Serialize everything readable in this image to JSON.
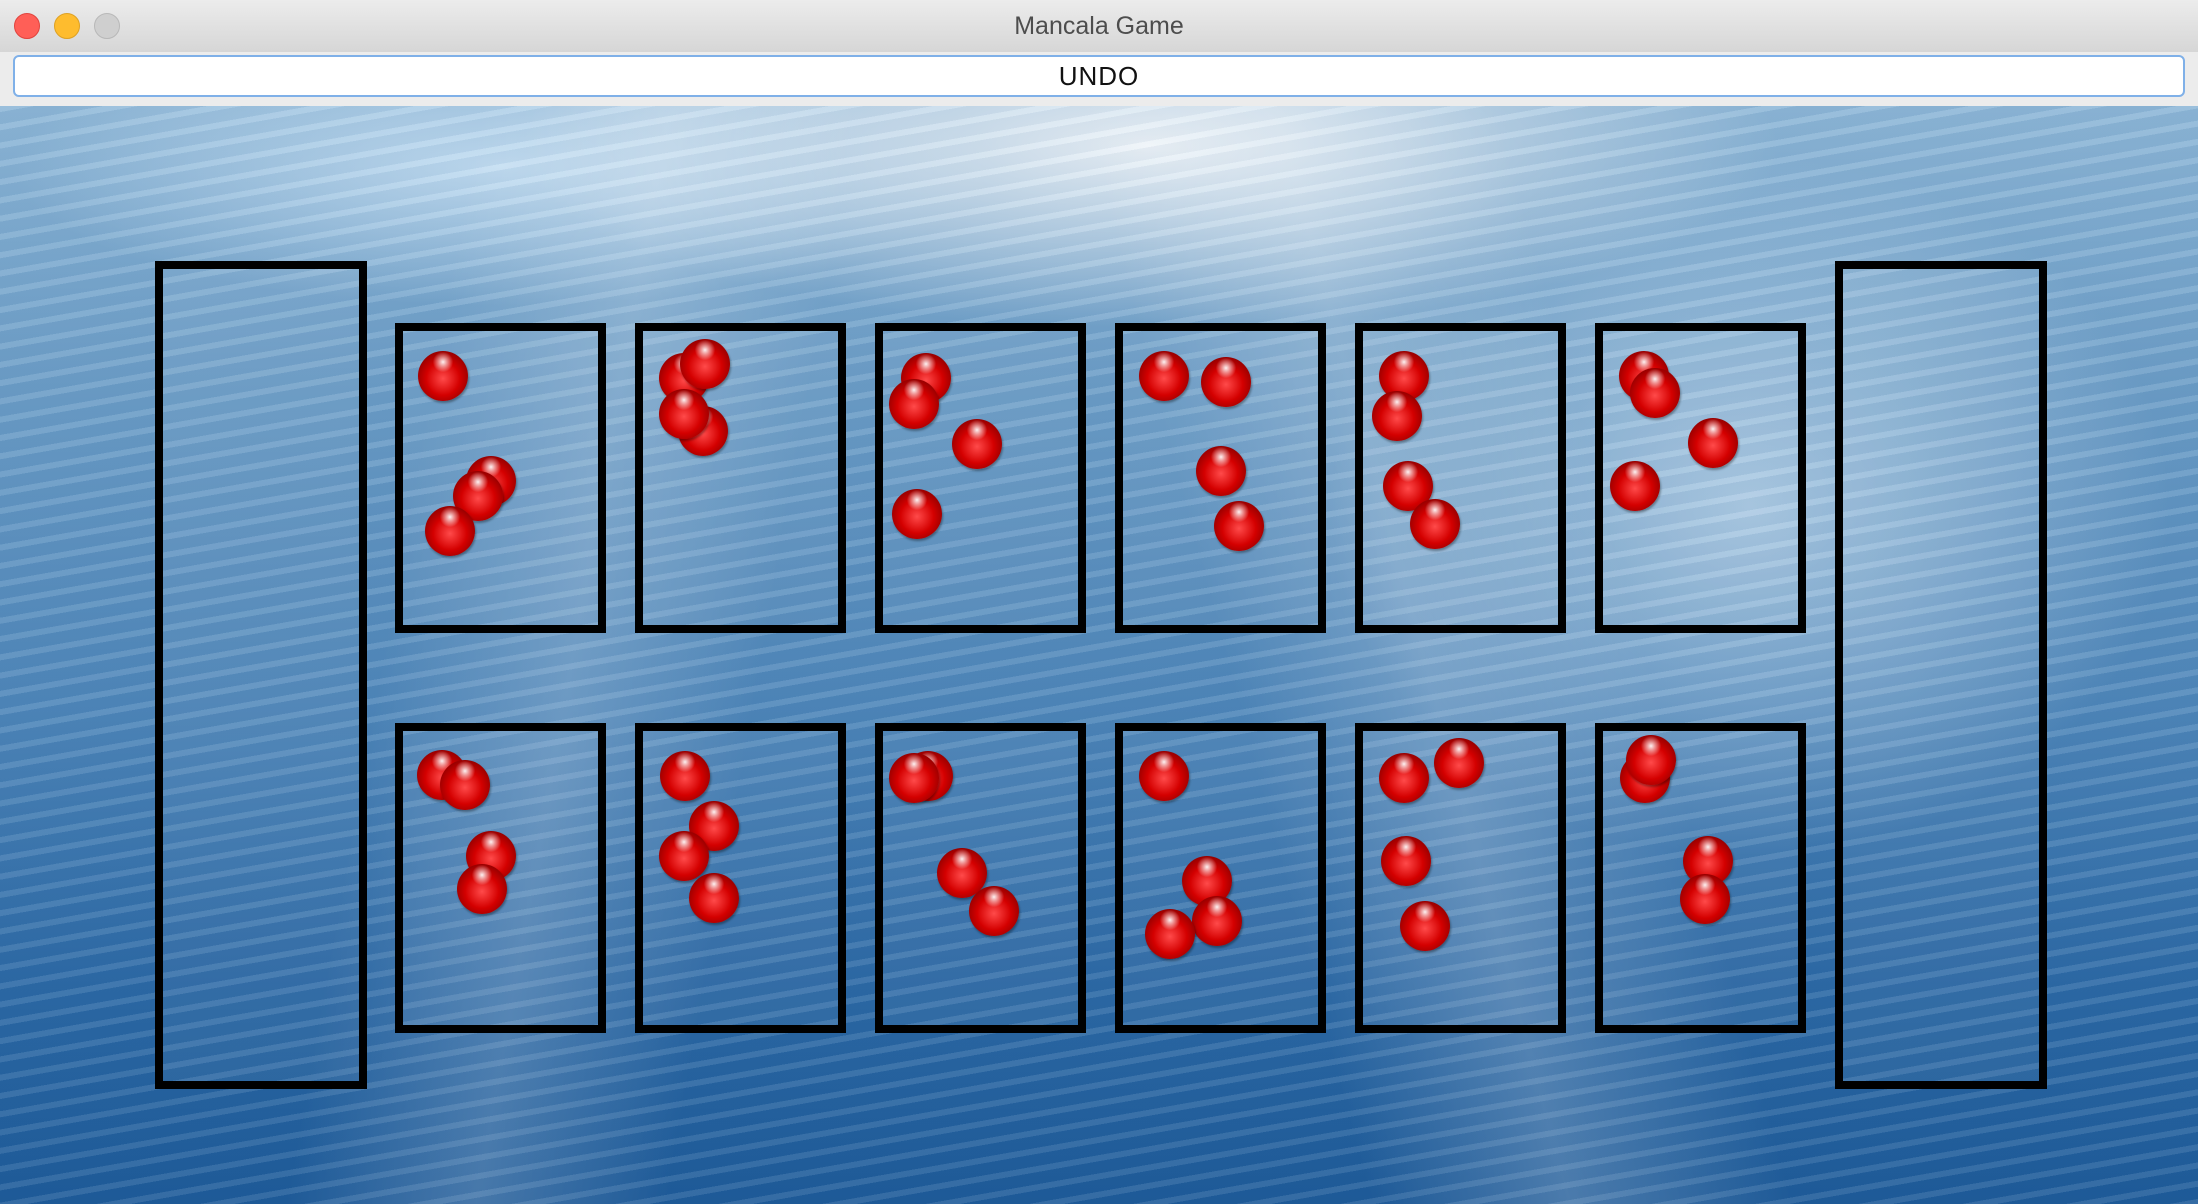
{
  "window": {
    "title": "Mancala Game"
  },
  "toolbar": {
    "undo_label": "UNDO"
  },
  "board": {
    "stone_color": "#d40000",
    "border_color": "#000000",
    "stores": [
      {
        "name": "left-store",
        "stones": 0
      },
      {
        "name": "right-store",
        "stones": 0
      }
    ],
    "top_row_stones": [
      4,
      4,
      4,
      4,
      4,
      4
    ],
    "bottom_row_stones": [
      4,
      4,
      4,
      4,
      4,
      4
    ]
  }
}
